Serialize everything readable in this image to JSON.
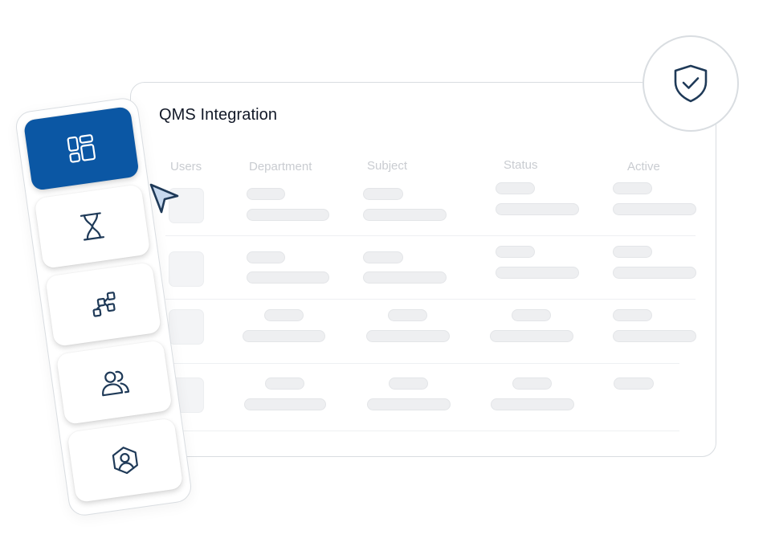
{
  "main": {
    "title": "QMS Integration",
    "columns": [
      "Users",
      "Department",
      "Subject",
      "Status",
      "Active"
    ]
  },
  "badge": {
    "icon": "shield-check-icon"
  },
  "sidebar": {
    "items": [
      {
        "icon": "dashboard-grid-icon",
        "active": true
      },
      {
        "icon": "hourglass-icon",
        "active": false
      },
      {
        "icon": "workflow-icon",
        "active": false
      },
      {
        "icon": "users-icon",
        "active": false
      },
      {
        "icon": "user-hexagon-icon",
        "active": false
      }
    ]
  },
  "cursor": {
    "icon": "pointer-arrow-icon"
  },
  "colors": {
    "accent": "#0b57a4",
    "icon_stroke": "#1f3a58",
    "placeholder": "#eeeff1",
    "border": "#d9dde1"
  }
}
